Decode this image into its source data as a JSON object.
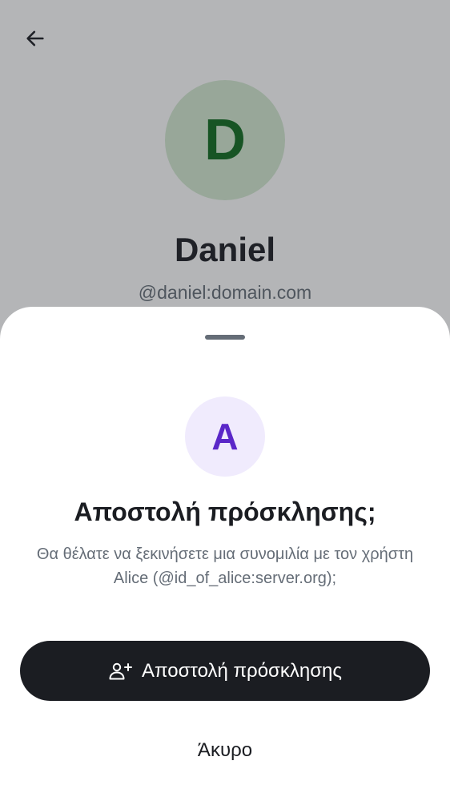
{
  "profile": {
    "avatar_letter": "D",
    "name": "Daniel",
    "user_id": "@daniel:domain.com"
  },
  "sheet": {
    "avatar_letter": "A",
    "title": "Αποστολή πρόσκλησης;",
    "description": "Θα θέλατε να ξεκινήσετε μια συνομιλία με τον χρήστη Alice (@id_of_alice:server.org);",
    "primary_button_label": "Αποστολή πρόσκλησης",
    "cancel_button_label": "Άκυρο"
  },
  "icons": {
    "back": "arrow-left-icon",
    "invite": "user-add-icon"
  },
  "colors": {
    "profile_avatar_bg": "#d4ead2",
    "profile_avatar_fg": "#0f6b1e",
    "invite_avatar_bg": "#f0ebfd",
    "invite_avatar_fg": "#5a27c8",
    "primary_button_bg": "#1b1d22"
  }
}
